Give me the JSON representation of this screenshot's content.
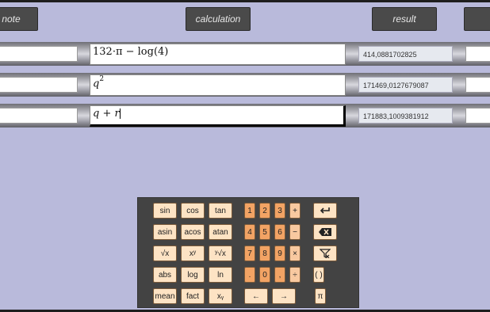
{
  "header": {
    "note_label": "note",
    "calculation_label": "calculation",
    "result_label": "result"
  },
  "rows": [
    {
      "calc_base": "132·π − log(4)",
      "calc_sup": "",
      "result": "414,0881702825"
    },
    {
      "calc_base": "q",
      "calc_sup": "2",
      "result": "171469,0127679087"
    },
    {
      "calc_base": "q + r",
      "calc_sup": "",
      "result": "171883,1009381912"
    }
  ],
  "keypad": {
    "functions": [
      [
        "sin",
        "cos",
        "tan"
      ],
      [
        "asin",
        "acos",
        "atan"
      ],
      [
        "√x",
        "xʸ",
        "ʸ√x"
      ],
      [
        "abs",
        "log",
        "ln"
      ],
      [
        "mean",
        "fact",
        "xᵧ"
      ]
    ],
    "numbers": [
      [
        "1",
        "2",
        "3",
        "+"
      ],
      [
        "4",
        "5",
        "6",
        "−"
      ],
      [
        "7",
        "8",
        "9",
        "×"
      ],
      [
        ".",
        "0",
        ",",
        "÷"
      ]
    ],
    "parens": "( )",
    "left_arrow": "←",
    "right_arrow": "→",
    "pi": "π",
    "enter_icon": "enter-icon",
    "backspace_icon": "backspace-icon",
    "clear_icon": "clear-icon"
  }
}
